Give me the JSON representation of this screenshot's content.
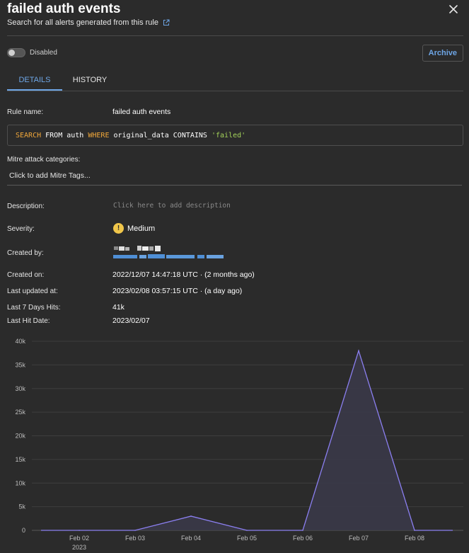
{
  "header": {
    "title": "failed auth events",
    "subtitle_link": "Search for all alerts generated from this rule",
    "close_icon": "close-icon",
    "external_link_icon": "external-link-icon"
  },
  "toggle": {
    "label": "Disabled",
    "state": "off"
  },
  "archive_label": "Archive",
  "tabs": [
    {
      "label": "DETAILS",
      "active": true
    },
    {
      "label": "HISTORY",
      "active": false
    }
  ],
  "fields": {
    "rule_name_label": "Rule name:",
    "rule_name_value": "failed auth events",
    "query": {
      "kw_search": "SEARCH",
      "t_from_auth": " FROM auth ",
      "kw_where": "WHERE",
      "t_cond": " original_data CONTAINS ",
      "str": "'failed'"
    },
    "mitre_label": "Mitre attack categories:",
    "mitre_placeholder": "Click to add Mitre Tags...",
    "description_label": "Description:",
    "description_placeholder": "Click here to add description",
    "severity_label": "Severity:",
    "severity_icon_glyph": "!",
    "severity_value": "Medium",
    "created_by_label": "Created by:",
    "created_on_label": "Created on:",
    "created_on_value": "2022/12/07 14:47:18 UTC · (2 months ago)",
    "last_updated_label": "Last updated at:",
    "last_updated_value": "2023/02/08 03:57:15 UTC · (a day ago)",
    "hits_label": "Last 7 Days Hits:",
    "hits_value": "41k",
    "last_hit_label": "Last Hit Date:",
    "last_hit_value": "2023/02/07"
  },
  "colors": {
    "accent": "#6ea6e6",
    "line": "#8b7ff0",
    "area": "#3a3848",
    "severity": "#f0c64a",
    "redacted": "#4f8fd6"
  },
  "chart_data": {
    "type": "area",
    "x": [
      "2023-02-02",
      "2023-02-03",
      "2023-02-04",
      "2023-02-05",
      "2023-02-06",
      "2023-02-07",
      "2023-02-08"
    ],
    "x_tick_labels": [
      "Feb 02",
      "Feb 03",
      "Feb 04",
      "Feb 05",
      "Feb 06",
      "Feb 07",
      "Feb 08"
    ],
    "x_year_label": "2023",
    "series": [
      {
        "values": [
          0,
          0,
          3000,
          0,
          0,
          38000,
          0
        ]
      }
    ],
    "y_ticks": [
      0,
      5000,
      10000,
      15000,
      20000,
      25000,
      30000,
      35000,
      40000
    ],
    "y_tick_labels": [
      "0",
      "5k",
      "10k",
      "15k",
      "20k",
      "25k",
      "30k",
      "35k",
      "40k"
    ],
    "ylim": [
      0,
      40000
    ],
    "grid": true
  }
}
